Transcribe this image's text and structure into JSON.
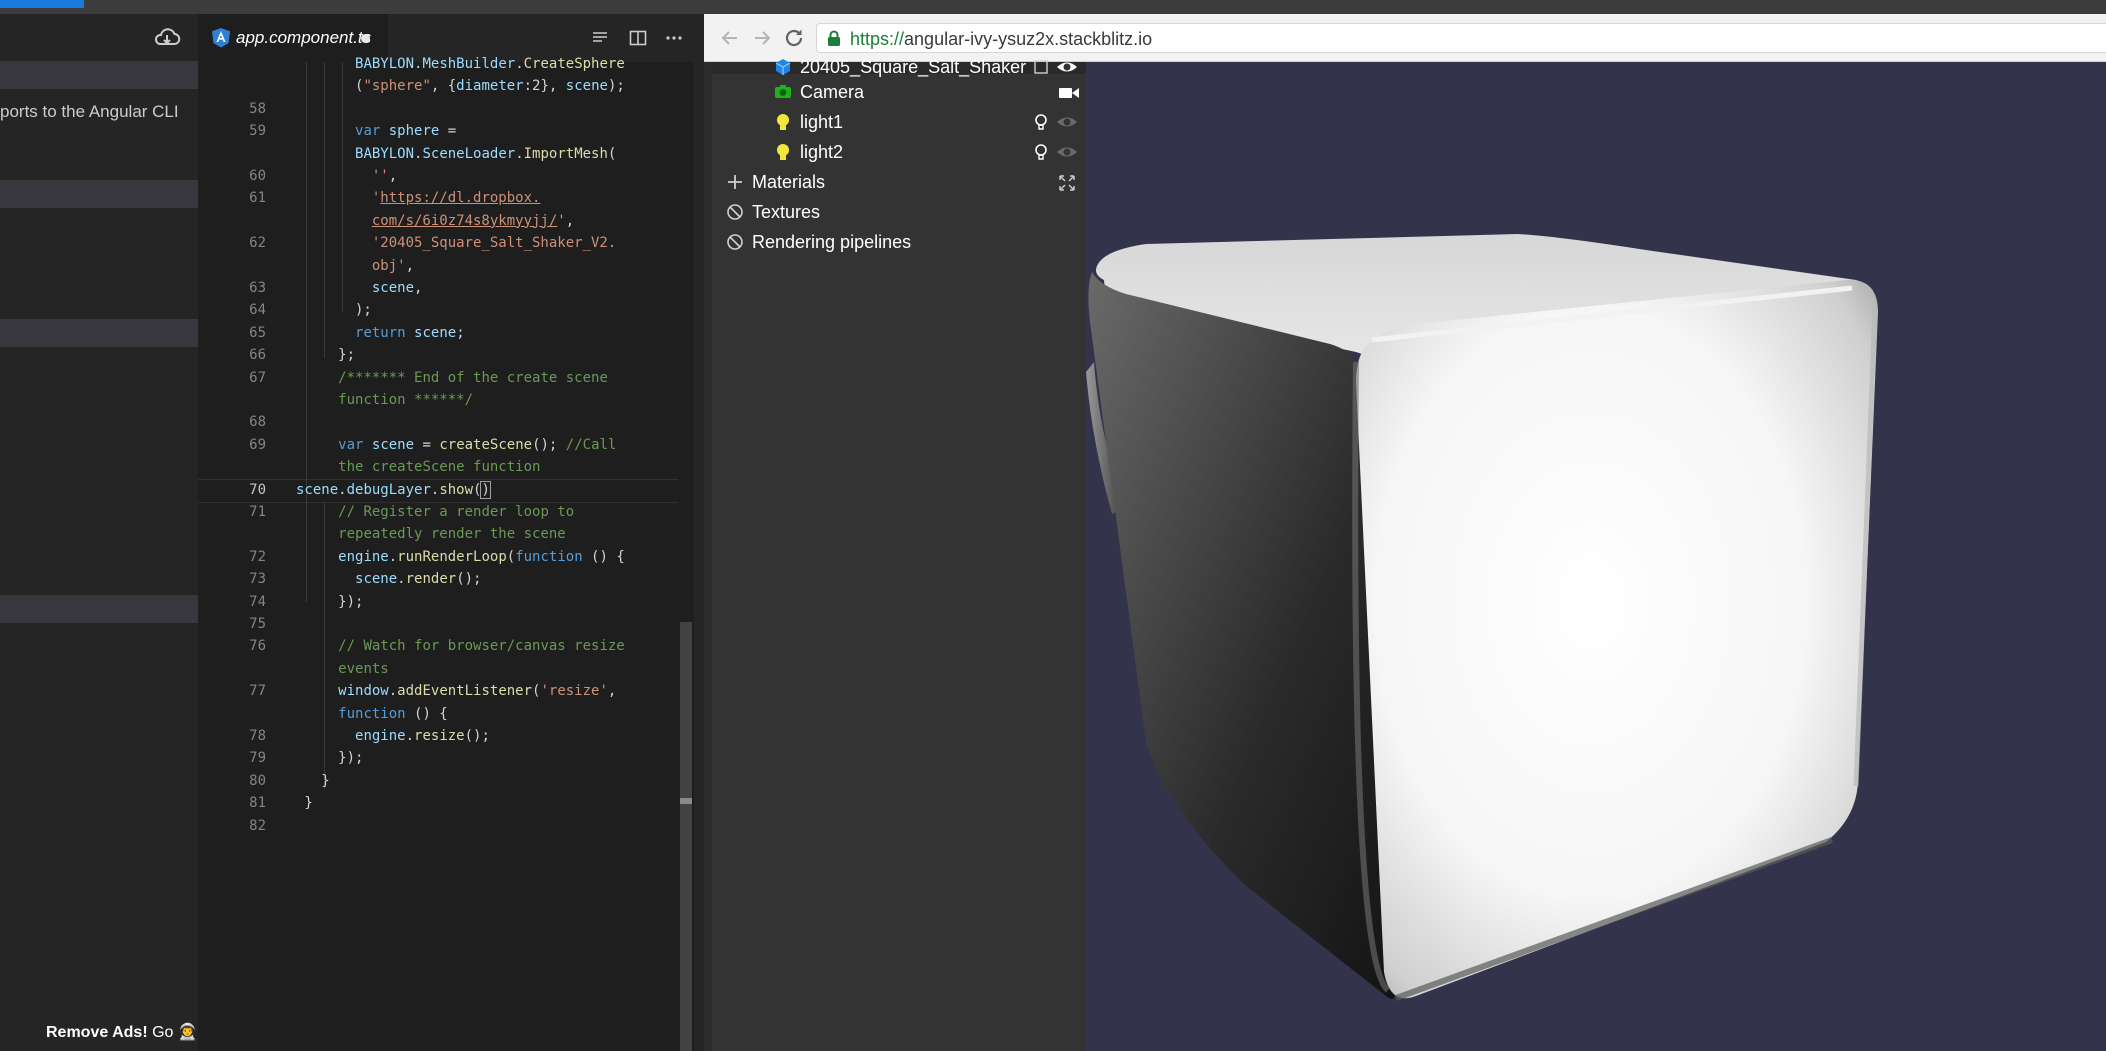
{
  "sidebar": {
    "visible_text": "ports to the Angular CLI",
    "ad": {
      "strong": "Remove Ads!",
      "rest": "Go 👨‍🚀🚀"
    }
  },
  "editor": {
    "tab": {
      "label": "app.component.ts"
    },
    "lines": [
      {
        "n": "",
        "html": "       <span class='var'>BABYLON</span>.<span class='var'>MeshBuilder</span>.<span class='fn'>CreateSphere</span>"
      },
      {
        "n": "",
        "html": "       (<span class='str'>\"sphere\"</span>, {<span class='var'>diameter</span>:<span class='num'>2</span>}, <span class='var'>scene</span>);"
      },
      {
        "n": "58",
        "html": ""
      },
      {
        "n": "59",
        "html": "       <span class='kw'>var</span> <span class='var'>sphere</span> ="
      },
      {
        "n": "",
        "html": "       <span class='var'>BABYLON</span>.<span class='var'>SceneLoader</span>.<span class='fn'>ImportMesh</span>("
      },
      {
        "n": "60",
        "html": "         <span class='str'>''</span>,"
      },
      {
        "n": "61",
        "html": "         <span class='str'>'<span class='url'>https://dl.dropbox.</span></span>"
      },
      {
        "n": "",
        "html": "         <span class='str'><span class='url'>com/s/6i0z74s8ykmyyjj/</span>'</span>,"
      },
      {
        "n": "62",
        "html": "         <span class='str'>'20405_Square_Salt_Shaker_V2.</span>"
      },
      {
        "n": "",
        "html": "         <span class='str'>obj'</span>,"
      },
      {
        "n": "63",
        "html": "         <span class='var'>scene</span>,"
      },
      {
        "n": "64",
        "html": "       );"
      },
      {
        "n": "65",
        "html": "       <span class='kw'>return</span> <span class='var'>scene</span>;"
      },
      {
        "n": "66",
        "html": "     };"
      },
      {
        "n": "67",
        "html": "     <span class='cm'>/******* End of the create scene</span>"
      },
      {
        "n": "",
        "html": "     <span class='cm'>function ******/</span>"
      },
      {
        "n": "68",
        "html": ""
      },
      {
        "n": "69",
        "html": "     <span class='kw'>var</span> <span class='var'>scene</span> = <span class='fn'>createScene</span>(); <span class='cm'>//Call</span>"
      },
      {
        "n": "",
        "html": "     <span class='cm'>the createScene function</span>"
      },
      {
        "n": "70",
        "html": "<span class='var'>scene</span>.<span class='var'>debugLayer</span>.<span class='fn'>show</span>(<span class='cursorbox'>)</span>",
        "current": true
      },
      {
        "n": "71",
        "html": "     <span class='cm'>// Register a render loop to</span>"
      },
      {
        "n": "",
        "html": "     <span class='cm'>repeatedly render the scene</span>"
      },
      {
        "n": "72",
        "html": "     <span class='var'>engine</span>.<span class='fn'>runRenderLoop</span>(<span class='kw'>function</span> () {"
      },
      {
        "n": "73",
        "html": "       <span class='var'>scene</span>.<span class='fn'>render</span>();"
      },
      {
        "n": "74",
        "html": "     });"
      },
      {
        "n": "75",
        "html": ""
      },
      {
        "n": "76",
        "html": "     <span class='cm'>// Watch for browser/canvas resize</span>"
      },
      {
        "n": "",
        "html": "     <span class='cm'>events</span>"
      },
      {
        "n": "77",
        "html": "     <span class='var'>window</span>.<span class='fn'>addEventListener</span>(<span class='str'>'resize'</span>,"
      },
      {
        "n": "",
        "html": "     <span class='kw'>function</span> () {"
      },
      {
        "n": "78",
        "html": "       <span class='var'>engine</span>.<span class='fn'>resize</span>();"
      },
      {
        "n": "79",
        "html": "     });"
      },
      {
        "n": "80",
        "html": "   }"
      },
      {
        "n": "81",
        "html": " }"
      },
      {
        "n": "82",
        "html": ""
      }
    ]
  },
  "browser": {
    "url": {
      "scheme": "https://",
      "host": "angular-ivy-ysuz2x.stackblitz.io"
    }
  },
  "inspector": {
    "nodes": [
      {
        "label": "20405_Square_Salt_Shaker",
        "icon": "mesh-icon"
      },
      {
        "label": "Camera",
        "icon": "camera-icon"
      },
      {
        "label": "light1",
        "icon": "bulb-icon"
      },
      {
        "label": "light2",
        "icon": "bulb-icon"
      }
    ],
    "sections": [
      {
        "label": "Materials",
        "icon": "plus-icon"
      },
      {
        "label": "Textures",
        "icon": "ban-icon"
      },
      {
        "label": "Rendering pipelines",
        "icon": "ban-icon"
      }
    ]
  },
  "colors": {
    "editor_bg": "#1e1e1e",
    "inspector_bg": "#333333",
    "canvas_bg": "#33334c",
    "url_scheme": "#188038",
    "light_icon": "#f3e83a",
    "camera_icon": "#1bb41b",
    "mesh_icon": "#1e88e5"
  }
}
